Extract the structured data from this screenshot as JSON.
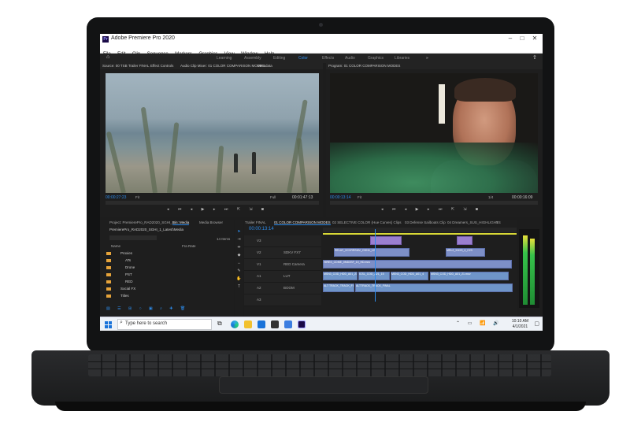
{
  "window": {
    "title": "Adobe Premiere Pro 2020",
    "app_icon_label": "Pr",
    "controls": [
      "–",
      "□",
      "✕"
    ]
  },
  "menu": [
    "File",
    "Edit",
    "Clip",
    "Sequence",
    "Markers",
    "Graphics",
    "View",
    "Window",
    "Help"
  ],
  "workspaces": {
    "items": [
      "Learning",
      "Assembly",
      "Editing",
      "Color",
      "Effects",
      "Audio",
      "Graphics",
      "Libraries"
    ],
    "active": "Color",
    "more": "»"
  },
  "source_monitor": {
    "tabs": [
      "Source: 00 TSB Trailer FINAL",
      "Effect Controls",
      "Audio Clip Mixer: 01 COLOR COMPARISON MODES",
      "Metadata"
    ],
    "timecode": "00:00:27:23",
    "fit": "Fit",
    "quality": "Full",
    "duration": "00:01:47:13"
  },
  "program_monitor": {
    "tab": "Program: 01 COLOR COMPARISON MODES",
    "timecode": "00:00:13:14",
    "fit": "Fit",
    "quality": "1/4",
    "duration": "00:00:16:09"
  },
  "project_panel": {
    "tabs": [
      "Project: PremierePro_RAD2020_SGHI_1",
      "Bin: Media",
      "Media Browser"
    ],
    "path": "PremierePro_RAD2020_SGHI_1_Latest\\Media",
    "item_count": "14 Items",
    "column_name": "Name",
    "column_frame_rate": "Fra Rate",
    "bins": [
      "Proxies",
      "ATs",
      "Drone",
      "PST",
      "RED",
      "Social FX",
      "Titles"
    ]
  },
  "timeline": {
    "tabs": [
      "Trailer FINAL",
      "01 COLOR COMPARISON MODES",
      "02 SELECTIVE COLOR (Hue Curves) Clips",
      "03 Defense Sailboats Clip",
      "04 Dreamers_SUS_HIGHLIGHTS",
      "5"
    ],
    "timecode": "00:00:13:14",
    "tracks": [
      "V3",
      "V2",
      "V1",
      "A1",
      "A2",
      "A3"
    ],
    "track_names": [
      "SDKV FX7",
      "RED Camera",
      "LUT",
      "BOOM"
    ],
    "clips": {
      "v3": [
        "RELAY_XCVRRSMV_C0011_LG",
        "MRL2_XUX9_4_C23"
      ],
      "v2": [
        "HIRES_CDME_0MD3SF_10_HD.mov"
      ],
      "v1": [
        "MSN3_COD_HDD_A01_21.ms",
        "ICSL_COD_A21_15",
        "MSN3_COD_HDD_A01_4",
        "MSN3_COD_HDD_A01_21.mov"
      ],
      "a1": [
        "ALT TRACK_TRACK_FINAL",
        "ALTTRACK_TRACK_FINAL"
      ]
    }
  },
  "taskbar": {
    "search_placeholder": "Type here to search",
    "time": "10:10 AM",
    "date": "4/1/2021"
  },
  "colors": {
    "accent": "#2d8ceb",
    "video_clip": "#9a7fd0",
    "audio_clip": "#6f95c9",
    "folder": "#e5a33a"
  }
}
